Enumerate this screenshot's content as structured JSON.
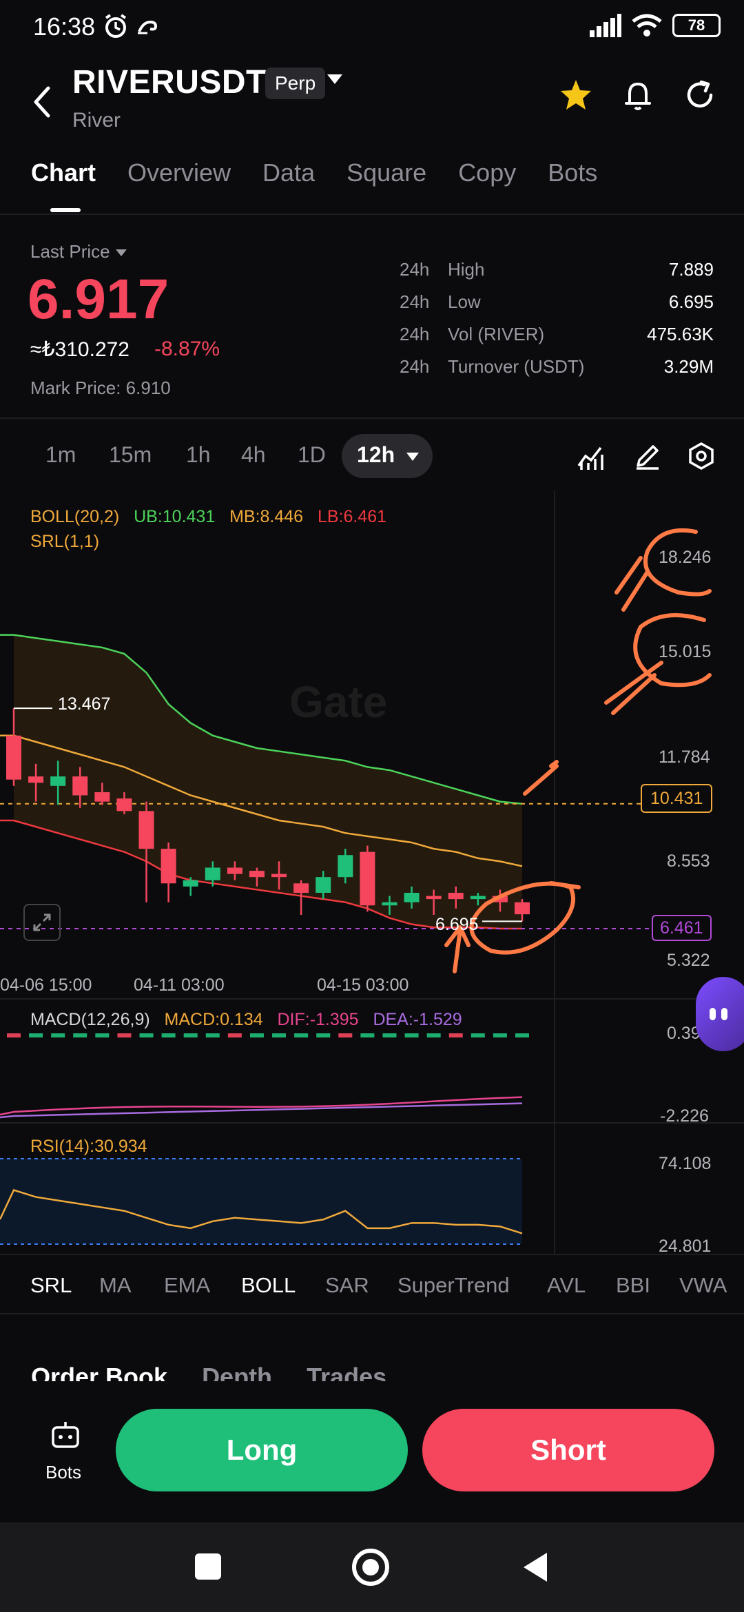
{
  "status_bar": {
    "time": "16:38",
    "battery": "78"
  },
  "header": {
    "pair": "RIVERUSDT",
    "contract_type": "Perp",
    "subtitle": "River"
  },
  "tabs": [
    "Chart",
    "Overview",
    "Data",
    "Square",
    "Copy",
    "Bots"
  ],
  "ticker": {
    "last_price_label": "Last Price",
    "last_price": "6.917",
    "local_price": "≈₺310.272",
    "change_pct": "-8.87%",
    "mark_price": "Mark Price: 6.910",
    "stats": [
      {
        "period": "24h",
        "label": "High",
        "value": "7.889"
      },
      {
        "period": "24h",
        "label": "Low",
        "value": "6.695"
      },
      {
        "period": "24h",
        "label": "Vol (RIVER)",
        "value": "475.63K"
      },
      {
        "period": "24h",
        "label": "Turnover (USDT)",
        "value": "3.29M"
      }
    ]
  },
  "intervals": [
    "1m",
    "15m",
    "1h",
    "4h",
    "1D"
  ],
  "active_interval": "12h",
  "chart": {
    "boll_legend": {
      "name": "BOLL(20,2)",
      "ub": "UB:10.431",
      "mb": "MB:8.446",
      "lb": "LB:6.461"
    },
    "srl_legend": "SRL(1,1)",
    "y_ticks": [
      "18.246",
      "15.015",
      "11.784",
      "8.553",
      "5.322"
    ],
    "ub_tag": "10.431",
    "lb_tag": "6.461",
    "high_marker": "13.467",
    "low_marker": "6.695",
    "x_ticks": [
      "04-06 15:00",
      "04-11 03:00",
      "04-15 03:00"
    ],
    "watermark": "Gate",
    "macd_legend": {
      "name": "MACD(12,26,9)",
      "macd": "MACD:0.134",
      "dif": "DIF:-1.395",
      "dea": "DEA:-1.529"
    },
    "macd_ticks": [
      "0.392",
      "-2.226"
    ],
    "rsi_legend": "RSI(14):30.934",
    "rsi_ticks": [
      "74.108",
      "24.801"
    ]
  },
  "indicators": [
    "SRL",
    "MA",
    "EMA",
    "BOLL",
    "SAR",
    "SuperTrend",
    "AVL",
    "BBI",
    "VWA"
  ],
  "active_indicator": "BOLL",
  "orderbook_tabs": [
    "Order Book",
    "Depth",
    "Trades"
  ],
  "footer": {
    "bots_label": "Bots",
    "long_label": "Long",
    "short_label": "Short"
  },
  "colors": {
    "up": "#1fbf7a",
    "down": "#f6465d",
    "ub": "#4cd35a",
    "mb": "#f0a93a",
    "lb": "#f0393f",
    "annotation": "#ff7a45"
  },
  "chart_data": {
    "type": "candlestick",
    "x_axis_labels": [
      "04-06 15:00",
      "04-11 03:00",
      "04-15 03:00"
    ],
    "ylim": [
      5.322,
      18.246
    ],
    "candles": [
      {
        "o": 12.6,
        "h": 13.467,
        "c": 11.2,
        "l": 11.0
      },
      {
        "o": 11.3,
        "h": 11.7,
        "c": 11.1,
        "l": 10.5
      },
      {
        "o": 11.0,
        "h": 11.8,
        "c": 11.3,
        "l": 10.4
      },
      {
        "o": 11.3,
        "h": 11.6,
        "c": 10.7,
        "l": 10.3
      },
      {
        "o": 10.8,
        "h": 11.1,
        "c": 10.5,
        "l": 10.4
      },
      {
        "o": 10.6,
        "h": 10.8,
        "c": 10.2,
        "l": 10.1
      },
      {
        "o": 10.2,
        "h": 10.5,
        "c": 9.0,
        "l": 7.3
      },
      {
        "o": 9.0,
        "h": 9.2,
        "c": 7.9,
        "l": 7.3
      },
      {
        "o": 7.8,
        "h": 8.1,
        "c": 8.0,
        "l": 7.5
      },
      {
        "o": 8.0,
        "h": 8.6,
        "c": 8.4,
        "l": 7.8
      },
      {
        "o": 8.4,
        "h": 8.6,
        "c": 8.2,
        "l": 8.0
      },
      {
        "o": 8.3,
        "h": 8.4,
        "c": 8.1,
        "l": 7.8
      },
      {
        "o": 8.2,
        "h": 8.6,
        "c": 8.1,
        "l": 7.7
      },
      {
        "o": 7.9,
        "h": 8.0,
        "c": 7.6,
        "l": 6.9
      },
      {
        "o": 7.6,
        "h": 8.3,
        "c": 8.1,
        "l": 7.4
      },
      {
        "o": 8.1,
        "h": 9.0,
        "c": 8.8,
        "l": 7.9
      },
      {
        "o": 8.9,
        "h": 9.1,
        "c": 7.2,
        "l": 7.0
      },
      {
        "o": 7.2,
        "h": 7.5,
        "c": 7.3,
        "l": 6.9
      },
      {
        "o": 7.3,
        "h": 7.8,
        "c": 7.6,
        "l": 7.1
      },
      {
        "o": 7.5,
        "h": 7.7,
        "c": 7.4,
        "l": 6.9
      },
      {
        "o": 7.6,
        "h": 7.8,
        "c": 7.4,
        "l": 7.1
      },
      {
        "o": 7.4,
        "h": 7.6,
        "c": 7.5,
        "l": 7.2
      },
      {
        "o": 7.5,
        "h": 7.7,
        "c": 7.3,
        "l": 7.0
      },
      {
        "o": 7.3,
        "h": 7.4,
        "c": 6.917,
        "l": 6.695
      }
    ],
    "ub_series": [
      15.8,
      15.7,
      15.6,
      15.5,
      15.4,
      15.2,
      14.6,
      13.6,
      13.0,
      12.6,
      12.4,
      12.2,
      12.1,
      12.0,
      11.9,
      11.8,
      11.6,
      11.5,
      11.3,
      11.1,
      10.9,
      10.7,
      10.5,
      10.431
    ],
    "mb_series": [
      12.6,
      12.4,
      12.2,
      12.0,
      11.8,
      11.6,
      11.3,
      11.0,
      10.7,
      10.5,
      10.3,
      10.1,
      9.9,
      9.8,
      9.7,
      9.5,
      9.4,
      9.3,
      9.2,
      9.0,
      8.9,
      8.7,
      8.6,
      8.446
    ],
    "lb_series": [
      9.9,
      9.7,
      9.5,
      9.3,
      9.1,
      8.9,
      8.6,
      8.2,
      8.0,
      7.9,
      7.8,
      7.7,
      7.6,
      7.5,
      7.4,
      7.3,
      7.1,
      6.8,
      6.6,
      6.5,
      6.5,
      6.5,
      6.46,
      6.461
    ]
  }
}
